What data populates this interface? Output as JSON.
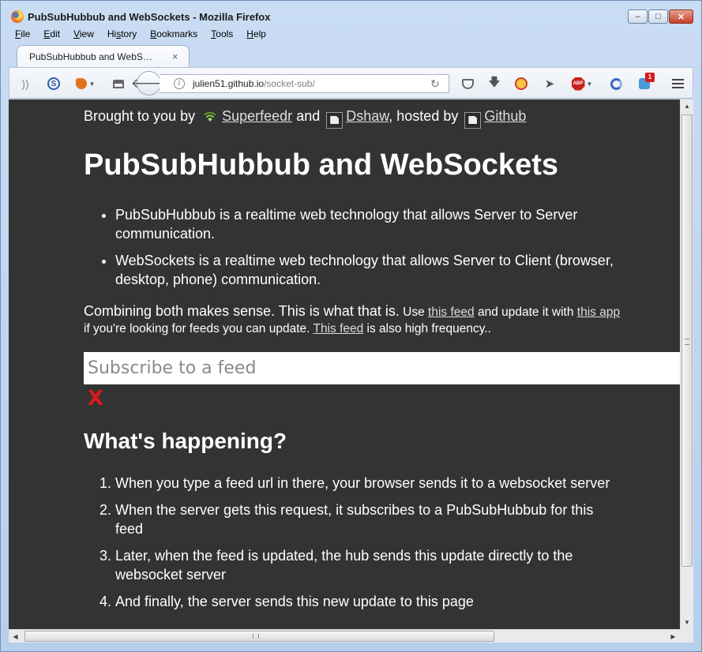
{
  "window": {
    "title": "PubSubHubbub and WebSockets - Mozilla Firefox",
    "minimize_glyph": "–",
    "maximize_glyph": "□",
    "close_glyph": "✕"
  },
  "menubar": {
    "items": [
      {
        "accel": "F",
        "rest": "ile"
      },
      {
        "accel": "E",
        "rest": "dit"
      },
      {
        "accel": "V",
        "rest": "iew"
      },
      {
        "accel": "",
        "rest": "Hi",
        "accel2": "s",
        "rest2": "tory"
      },
      {
        "accel": "B",
        "rest": "ookmarks"
      },
      {
        "accel": "T",
        "rest": "ools"
      },
      {
        "accel": "H",
        "rest": "elp"
      }
    ]
  },
  "tab": {
    "label": "PubSubHubbub and WebS…",
    "close_glyph": "×"
  },
  "navbar": {
    "back_glyph": "🡐",
    "url_host": "julien51.github.io",
    "url_path": "/socket-sub/",
    "info_glyph": "i",
    "reload_glyph": "↻",
    "download_glyph": "🡇",
    "send_glyph": "➤",
    "rss_glyph": "))",
    "stylish_letter": "S",
    "abp_label": "ABP",
    "extension_badge": "1",
    "dropdown_glyph": "▼"
  },
  "page": {
    "credits_prefix": "Brought to you by",
    "credits_superfeedr": "Superfeedr",
    "credits_and": "and",
    "credits_dshaw": "Dshaw",
    "credits_hosted": ", hosted by",
    "credits_github": "Github",
    "title": "PubSubHubbub and WebSockets",
    "intro_items": [
      "PubSubHubbub is a realtime web technology that allows Server to Server communication.",
      "WebSockets is a realtime web technology that allows Server to Client (browser, desktop, phone) communication."
    ],
    "combine_big": "Combining both makes sense. This is what that is.",
    "combine_use": " Use ",
    "combine_link1": "this feed",
    "combine_mid": " and update it with ",
    "combine_link2": "this app",
    "combine_mid2": " if you're looking for feeds you can update. ",
    "combine_link3": "This feed",
    "combine_end": " is also high frequency..",
    "input_placeholder": "Subscribe to a feed",
    "clear_label": "X",
    "section_heading": "What's happening?",
    "steps": [
      "When you type a feed url in there, your browser sends it to a websocket server",
      "When the server gets this request, it subscribes to a PubSubHubbub for this feed",
      "Later, when the feed is updated, the hub sends this update directly to the websocket server",
      "And finally, the server sends this new update to this page"
    ]
  },
  "scrollbars": {
    "up_glyph": "▲",
    "down_glyph": "▼",
    "left_glyph": "◀",
    "right_glyph": "▶"
  },
  "colors": {
    "page_background": "#333333",
    "clear_red": "#d91a1a",
    "wifi_green": "#8fcf3c",
    "abp_red": "#c9211e"
  }
}
